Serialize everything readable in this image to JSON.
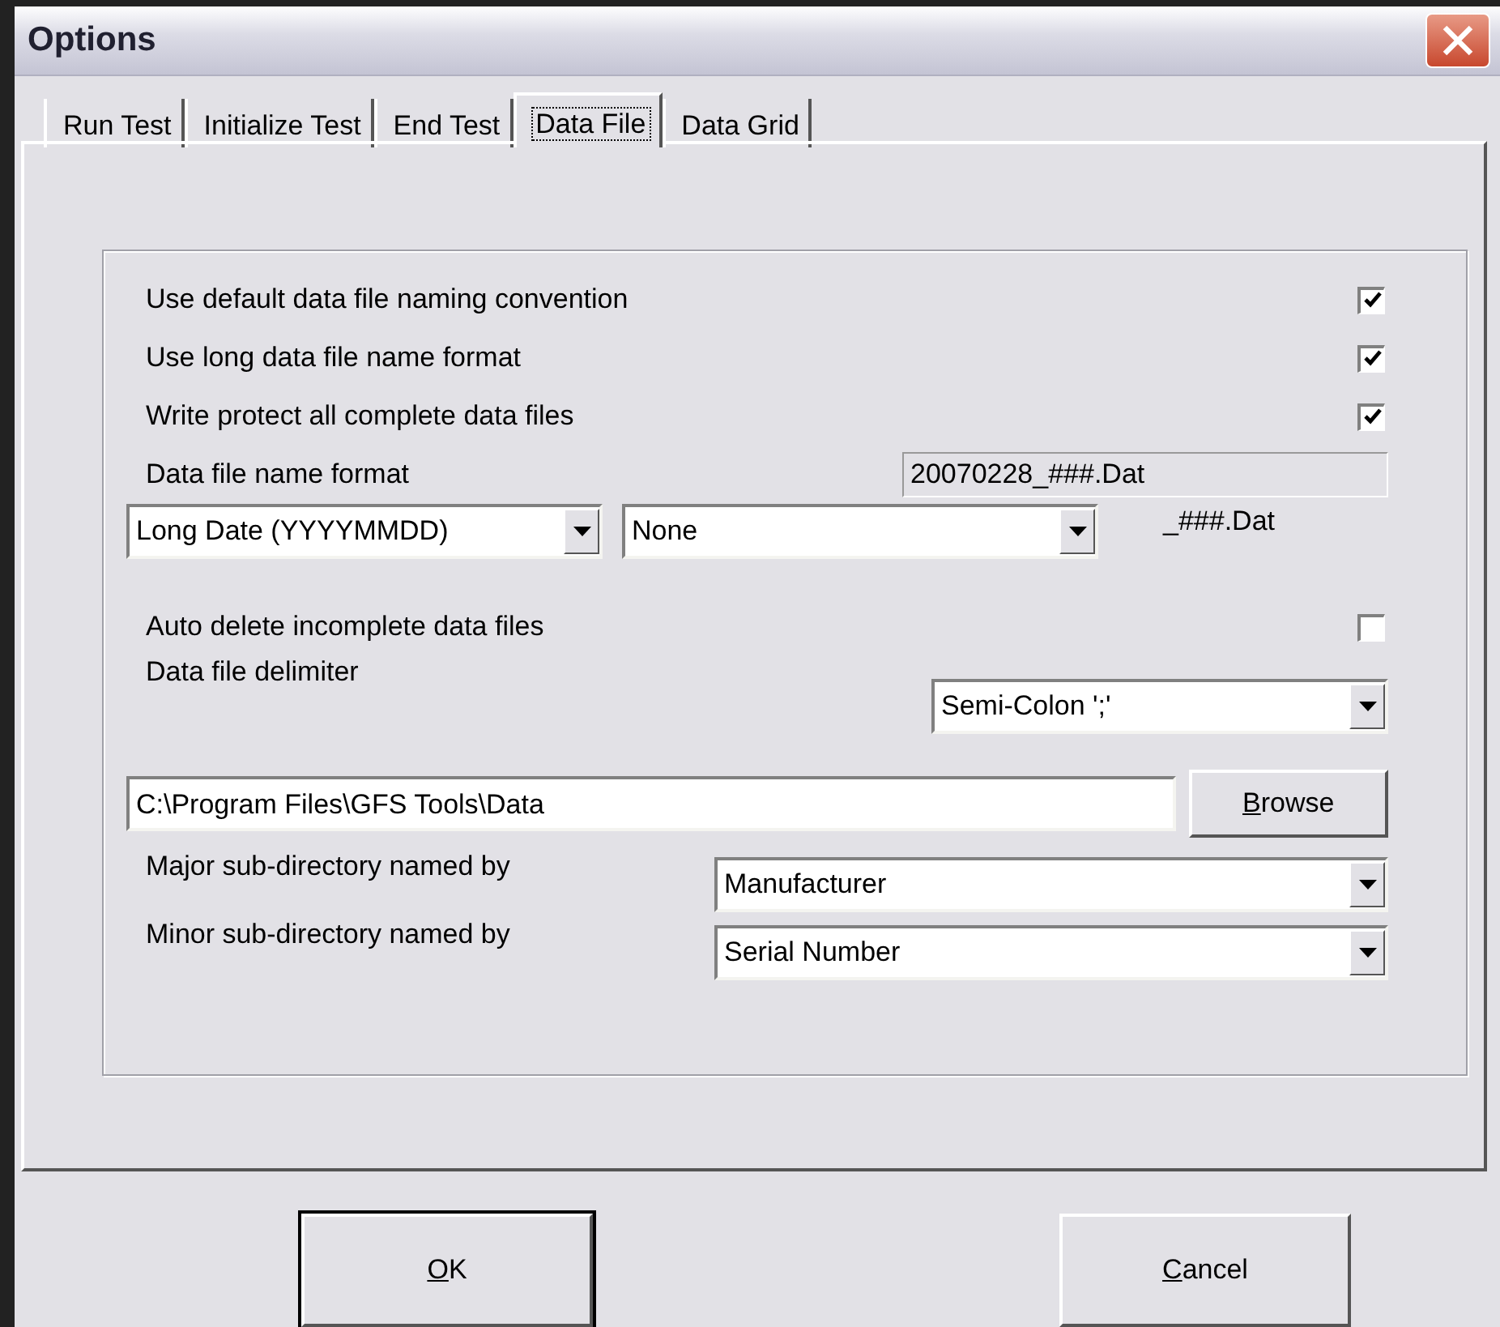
{
  "window": {
    "title": "Options"
  },
  "tabs": [
    {
      "label": "Run Test",
      "selected": false
    },
    {
      "label": "Initialize Test",
      "selected": false
    },
    {
      "label": "End Test",
      "selected": false
    },
    {
      "label": "Data File",
      "selected": true
    },
    {
      "label": "Data Grid",
      "selected": false
    }
  ],
  "checkboxes": [
    {
      "label": "Use default data file naming convention",
      "checked": true
    },
    {
      "label": "Use long data file name format",
      "checked": true
    },
    {
      "label": "Write protect all complete data files",
      "checked": true
    }
  ],
  "name_format": {
    "label": "Data file name format",
    "preview": "20070228_###.Dat",
    "date_combo": "Long Date (YYYYMMDD)",
    "second_combo": "None",
    "suffix": "_###.Dat"
  },
  "auto_delete": {
    "label": "Auto delete incomplete data files",
    "checked": false
  },
  "delimiter": {
    "label": "Data file delimiter",
    "value": "Semi-Colon ';'"
  },
  "path": {
    "value": "C:\\Program Files\\GFS Tools\\Data",
    "browse": {
      "accelerator": "B",
      "rest": "rowse"
    }
  },
  "subdirectories": [
    {
      "label": "Major sub-directory named by",
      "value": "Manufacturer"
    },
    {
      "label": "Minor sub-directory named by",
      "value": "Serial Number"
    }
  ],
  "buttons": [
    {
      "accelerator": "O",
      "rest": "K",
      "default": true
    },
    {
      "accelerator": "C",
      "rest": "ancel",
      "default": false
    }
  ]
}
